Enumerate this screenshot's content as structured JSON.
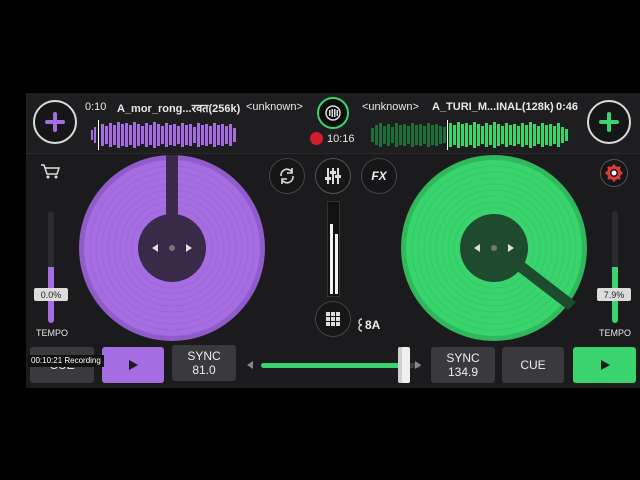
{
  "colors": {
    "left_accent": "#a56de2",
    "right_accent": "#3ad46e",
    "background": "#1b1b1d"
  },
  "deck_left": {
    "time": "0:10",
    "title": "A_mor_rong...रवत(256k)",
    "artist": "<unknown>",
    "tempo_value": "0.0%",
    "tempo_label": "TEMPO",
    "cue_label": "CUE",
    "sync_label": "SYNC",
    "bpm": "81.0"
  },
  "deck_right": {
    "time": "0:46",
    "title": "A_TURI_M...INAL(128k)",
    "artist": "<unknown>",
    "tempo_value": "7.9%",
    "tempo_label": "TEMPO",
    "cue_label": "CUE",
    "sync_label": "SYNC",
    "bpm": "134.9"
  },
  "center": {
    "record_time": "10:16",
    "fx_label": "FX",
    "key_label": "8A",
    "crossfader_position": 0.93
  },
  "overlay": {
    "recording_text": "00:10:21  Recording"
  },
  "icons": [
    "add-icon",
    "cart-icon",
    "sync-cycle-icon",
    "mixer-sliders-icon",
    "fx-icon",
    "gear-icon",
    "grid-icon",
    "play-icon",
    "record-icon",
    "logo-icon",
    "key-icon"
  ]
}
